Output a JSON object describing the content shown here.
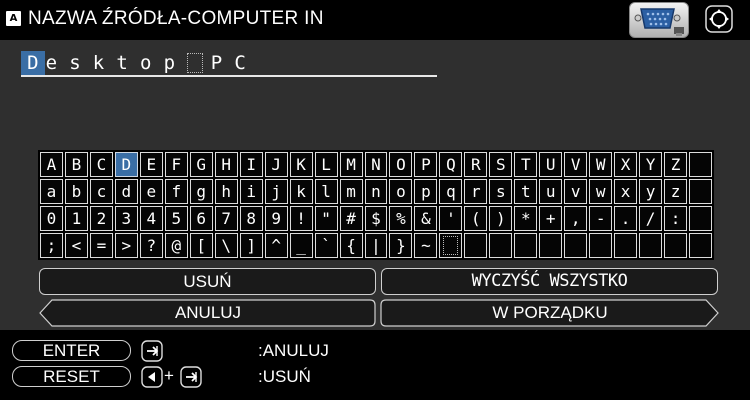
{
  "title_bar": {
    "badge": "A",
    "title": "NAZWA ŹRÓDŁA-COMPUTER IN",
    "connector_icon": "vga-connector-icon",
    "nav_icon": "target-icon"
  },
  "name_field": {
    "chars": [
      "D",
      "e",
      "s",
      "k",
      "t",
      "o",
      "p",
      " ",
      "P",
      "C"
    ],
    "cursor_index": 0
  },
  "keyboard": {
    "rows": [
      [
        "A",
        "B",
        "C",
        "D",
        "E",
        "F",
        "G",
        "H",
        "I",
        "J",
        "K",
        "L",
        "M",
        "N",
        "O",
        "P",
        "Q",
        "R",
        "S",
        "T",
        "U",
        "V",
        "W",
        "X",
        "Y",
        "Z"
      ],
      [
        "a",
        "b",
        "c",
        "d",
        "e",
        "f",
        "g",
        "h",
        "i",
        "j",
        "k",
        "l",
        "m",
        "n",
        "o",
        "p",
        "q",
        "r",
        "s",
        "t",
        "u",
        "v",
        "w",
        "x",
        "y",
        "z"
      ],
      [
        "0",
        "1",
        "2",
        "3",
        "4",
        "5",
        "6",
        "7",
        "8",
        "9",
        "!",
        "\"",
        "#",
        "$",
        "%",
        "&",
        "'",
        "(",
        ")",
        "*",
        "+",
        ",",
        "-",
        ".",
        "/",
        ":"
      ],
      [
        ";",
        "<",
        "=",
        ">",
        "?",
        "@",
        "[",
        "\\",
        "]",
        "^",
        "_",
        "`",
        "{",
        "|",
        "}",
        "~",
        " "
      ]
    ],
    "selected": "D"
  },
  "actions": {
    "delete": "USUŃ",
    "clear_all": "WYCZYŚĆ WSZYSTKO",
    "cancel": "ANULUJ",
    "ok": "W PORZĄDKU"
  },
  "hints": [
    {
      "key": "ENTER",
      "combo_icon": "enter-icon",
      "action": ":ANULUJ"
    },
    {
      "key": "RESET",
      "combo_icon": "left-plus-enter-icon",
      "plus": "+",
      "action": ":USUŃ"
    }
  ],
  "colors": {
    "panel": "#2f2f2f",
    "selection": "#3a6ea5",
    "background": "#000000"
  }
}
